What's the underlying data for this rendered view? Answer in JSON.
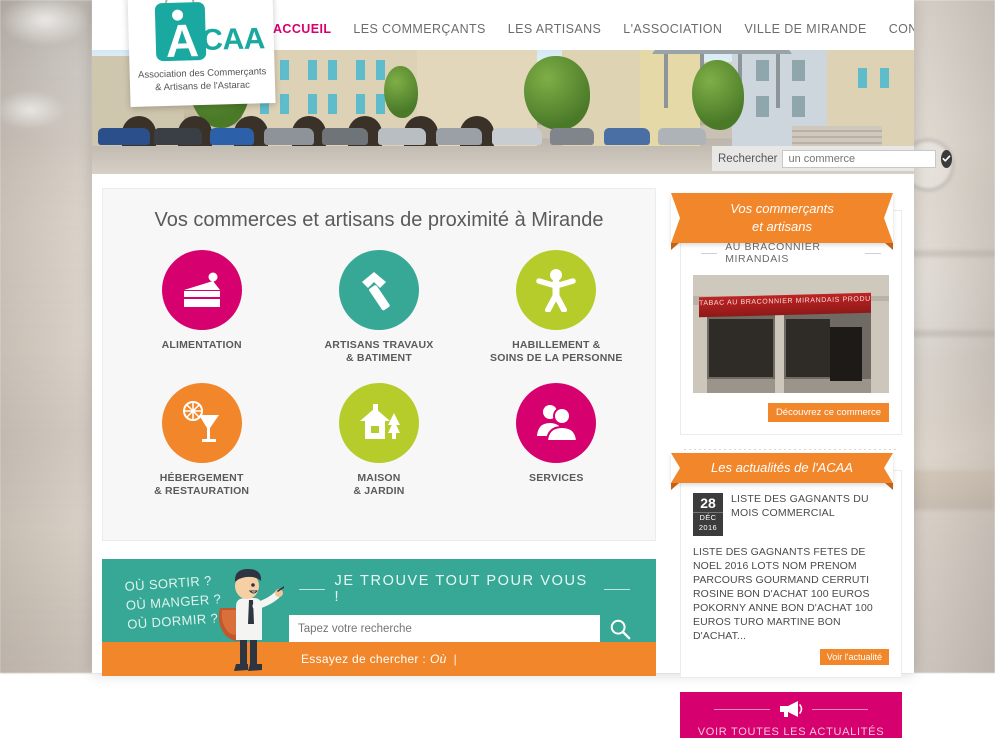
{
  "nav": {
    "items": [
      {
        "label": "ACCUEIL",
        "active": true
      },
      {
        "label": "LES COMMERÇANTS",
        "active": false
      },
      {
        "label": "LES ARTISANS",
        "active": false
      },
      {
        "label": "L'ASSOCIATION",
        "active": false
      },
      {
        "label": "VILLE DE MIRANDE",
        "active": false
      },
      {
        "label": "CONTACT",
        "active": false
      }
    ]
  },
  "logo": {
    "mark_letter": "A",
    "mark_rest": "CAA",
    "subtitle_line1": "Association des Commerçants",
    "subtitle_line2": "& Artisans de l'Astarac",
    "teal": "#1aa9a0"
  },
  "hero_search": {
    "label": "Rechercher",
    "placeholder": "un commerce",
    "value": "",
    "go_icon": "check-circle-icon"
  },
  "categories": {
    "title": "Vos commerces et artisans de proximité à Mirande",
    "items": [
      {
        "label_line1": "ALIMENTATION",
        "label_line2": "",
        "color": "#d6006e",
        "icon": "cake-slice-icon"
      },
      {
        "label_line1": "ARTISANS TRAVAUX",
        "label_line2": "& BATIMENT",
        "color": "#36a895",
        "icon": "hammer-icon"
      },
      {
        "label_line1": "HABILLEMENT &",
        "label_line2": "SOINS DE LA PERSONNE",
        "color": "#b5cc2b",
        "icon": "person-icon"
      },
      {
        "label_line1": "HÉBERGEMENT",
        "label_line2": "& RESTAURATION",
        "color": "#f2862a",
        "icon": "drink-glass-icon"
      },
      {
        "label_line1": "MAISON",
        "label_line2": "& JARDIN",
        "color": "#b5cc2b",
        "icon": "house-tree-icon"
      },
      {
        "label_line1": "SERVICES",
        "label_line2": "",
        "color": "#d6006e",
        "icon": "people-icon"
      }
    ]
  },
  "find_block": {
    "questions": [
      "OÙ SORTIR ?",
      "OÙ MANGER ?",
      "OÙ DORMIR ?"
    ],
    "heading": "JE TROUVE TOUT POUR VOUS !",
    "input_placeholder": "Tapez votre recherche",
    "input_value": "",
    "search_icon": "magnifier-icon",
    "try_label": "Essayez de chercher :",
    "try_value": "Où",
    "background": "#36a895",
    "try_background": "#f2862a"
  },
  "sidebar": {
    "merchants_widget": {
      "ribbon_line1": "Vos commerçants",
      "ribbon_line2": "et artisans",
      "subtitle": "AU BRACONNIER MIRANDAIS",
      "photo_sign": "TABAC   AU BRACONNIER MIRANDAIS   PRODUITS REGIONAUX",
      "button_label": "Découvrez ce commerce"
    },
    "news_widget": {
      "ribbon": "Les actualités de l'ACAA",
      "date_day": "28",
      "date_month": "DÉC",
      "date_year": "2016",
      "title": "LISTE DES GAGNANTS DU MOIS COMMERCIAL",
      "excerpt": "LISTE DES GAGNANTS FETES DE NOEL 2016 LOTS NOM PRENOM PARCOURS GOURMAND CERRUTI ROSINE BON D'ACHAT 100 EUROS POKORNY ANNE BON D'ACHAT 100 EUROS TURO MARTINE BON D'ACHAT...",
      "button_label": "Voir l'actualité"
    },
    "news_cta": {
      "icon": "megaphone-icon",
      "label": "VOIR TOUTES LES ACTUALITÉS",
      "background": "#d6006e"
    }
  }
}
